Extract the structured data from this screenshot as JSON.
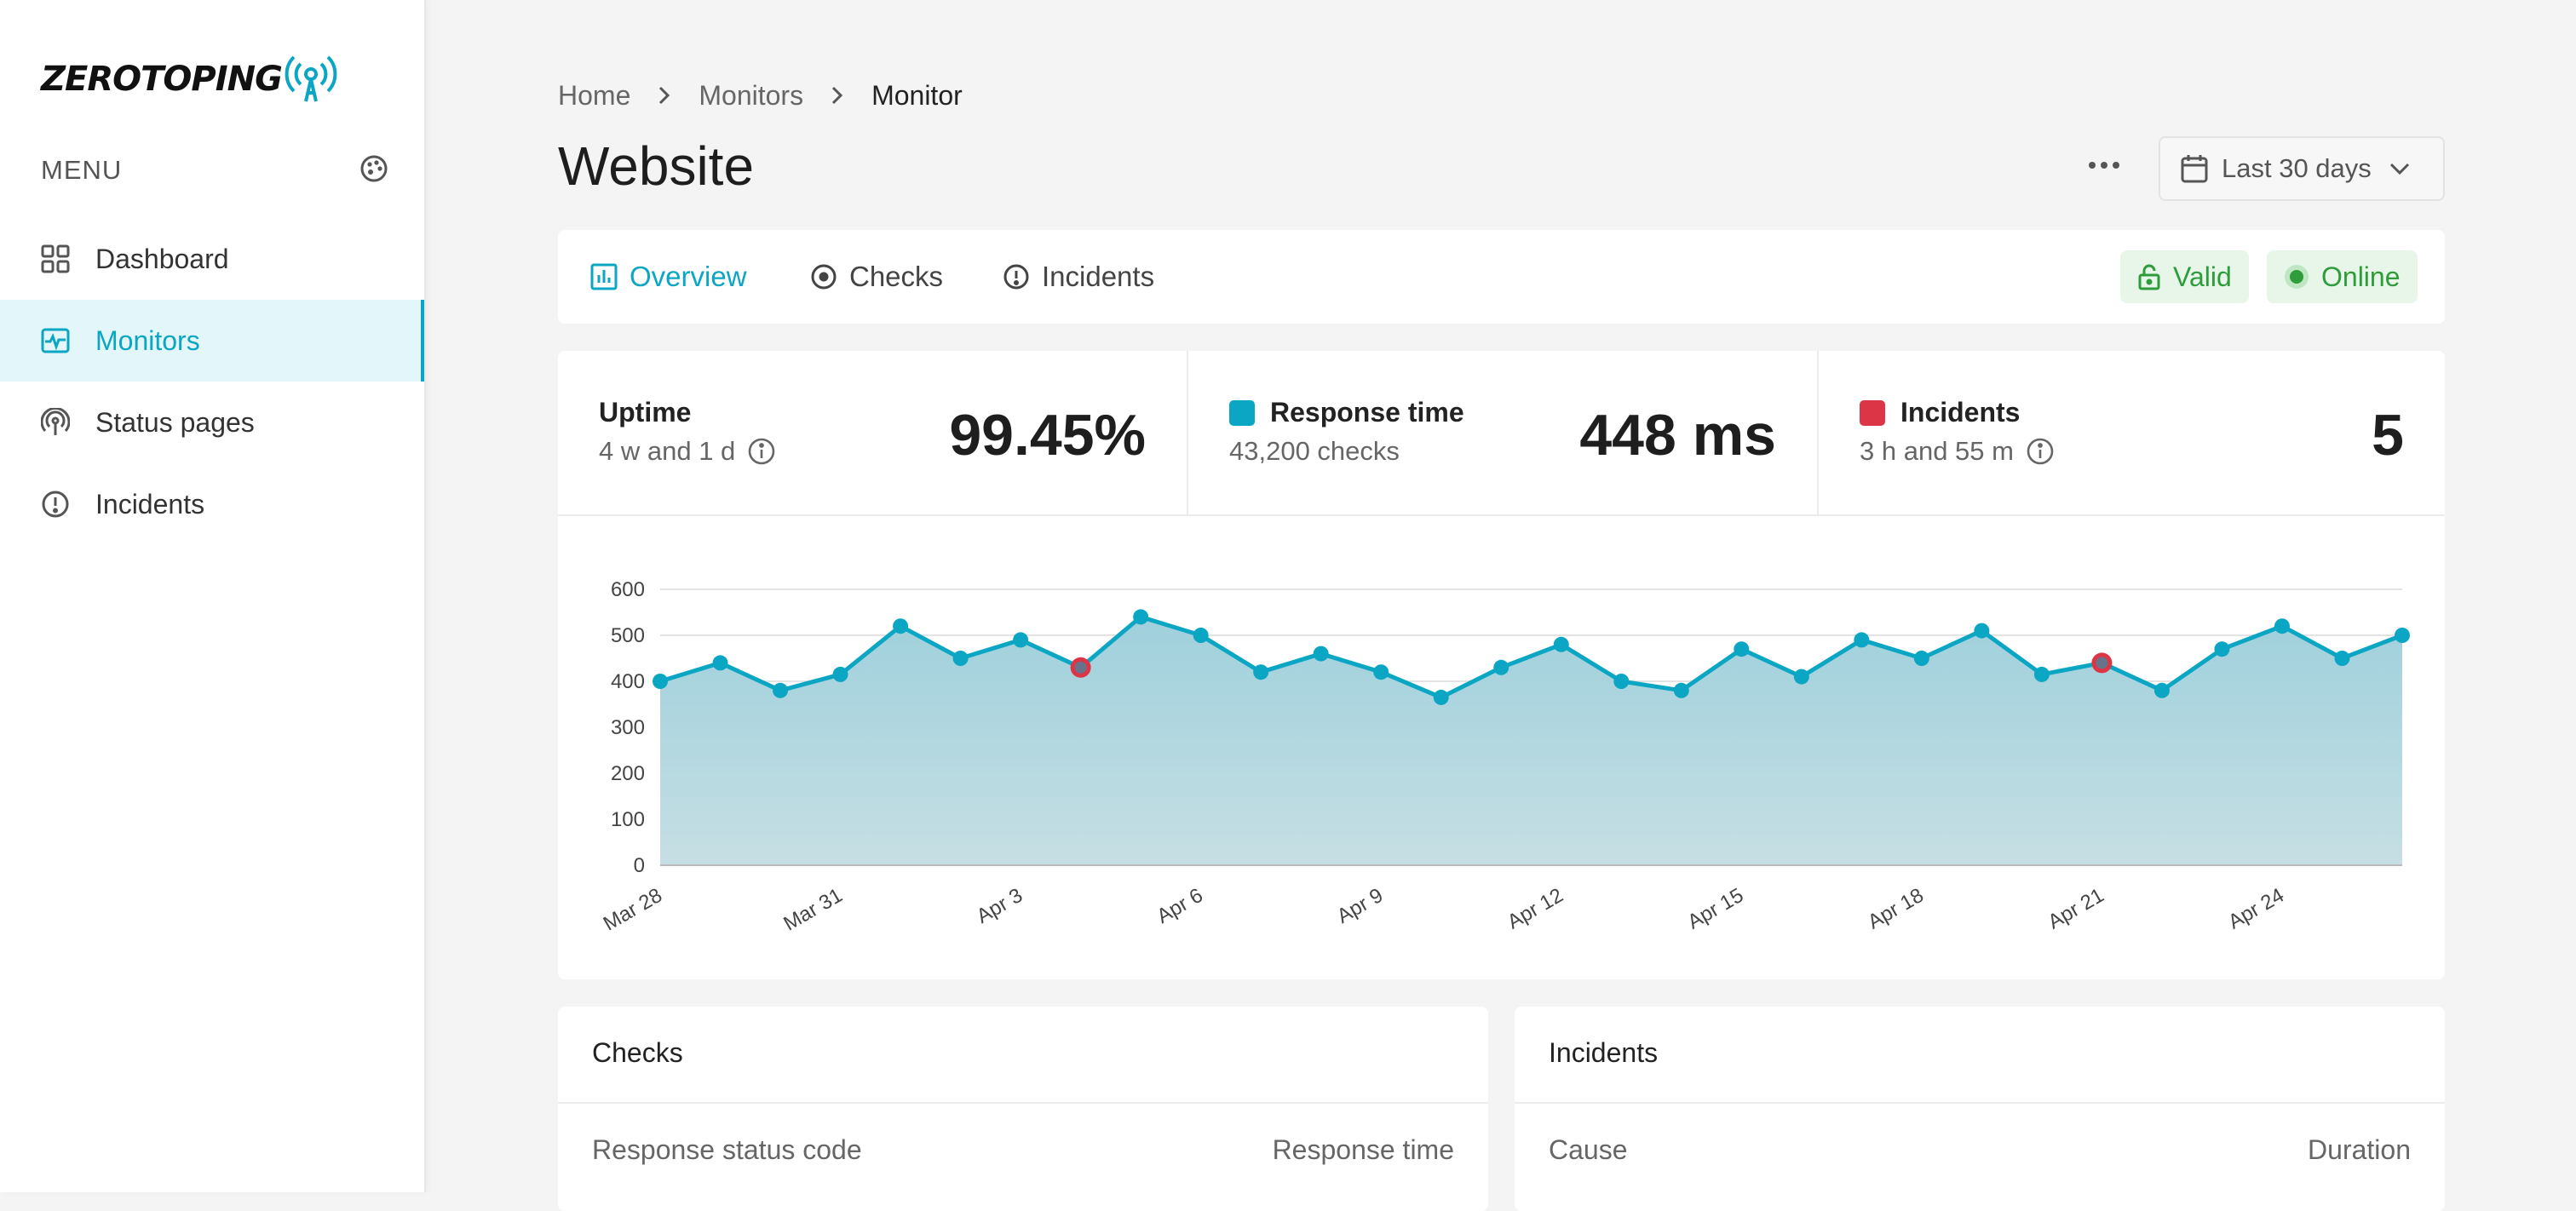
{
  "app": {
    "logo_text": "ZEROTOPING",
    "logo_icon": "broadcast-tower-icon"
  },
  "sidebar": {
    "menu_label": "MENU",
    "menu_icon": "palette-icon",
    "items": [
      {
        "label": "Dashboard",
        "icon": "grid-icon",
        "active": false
      },
      {
        "label": "Monitors",
        "icon": "monitor-pulse-icon",
        "active": true
      },
      {
        "label": "Status pages",
        "icon": "broadcast-icon",
        "active": false
      },
      {
        "label": "Incidents",
        "icon": "alert-circle-icon",
        "active": false
      }
    ]
  },
  "breadcrumb": [
    "Home",
    "Monitors",
    "Monitor"
  ],
  "page": {
    "title": "Website"
  },
  "header_actions": {
    "more_icon": "ellipsis-icon",
    "date_range": "Last 30 days"
  },
  "tabs": [
    {
      "label": "Overview",
      "icon": "bar-chart-icon",
      "active": true
    },
    {
      "label": "Checks",
      "icon": "target-icon",
      "active": false
    },
    {
      "label": "Incidents",
      "icon": "alert-circle-icon",
      "active": false
    }
  ],
  "badges": {
    "ssl": "Valid",
    "status": "Online"
  },
  "stats": {
    "uptime": {
      "title": "Uptime",
      "sub": "4 w and 1 d",
      "value": "99.45%"
    },
    "response": {
      "title": "Response time",
      "sub": "43,200 checks",
      "value": "448 ms",
      "color": "#0aa6c4"
    },
    "incidents": {
      "title": "Incidents",
      "sub": "3 h and 55 m",
      "value": "5",
      "color": "#dc3545"
    }
  },
  "colors": {
    "accent": "#0aa6c4",
    "incident": "#dc3545",
    "online": "#2e9c3b"
  },
  "chart_data": {
    "type": "area",
    "title": "",
    "xlabel": "",
    "ylabel": "",
    "ylim": [
      0,
      600
    ],
    "yticks": [
      0,
      100,
      200,
      300,
      400,
      500,
      600
    ],
    "x": [
      "Mar 28",
      "Mar 29",
      "Mar 30",
      "Mar 31",
      "Apr 1",
      "Apr 2",
      "Apr 3",
      "Apr 4",
      "Apr 5",
      "Apr 6",
      "Apr 7",
      "Apr 8",
      "Apr 9",
      "Apr 10",
      "Apr 11",
      "Apr 12",
      "Apr 13",
      "Apr 14",
      "Apr 15",
      "Apr 16",
      "Apr 17",
      "Apr 18",
      "Apr 19",
      "Apr 20",
      "Apr 21",
      "Apr 22",
      "Apr 23",
      "Apr 24",
      "Apr 25",
      "Apr 26"
    ],
    "xtick_labels": [
      "Mar 28",
      "Mar 31",
      "Apr 3",
      "Apr 6",
      "Apr 9",
      "Apr 12",
      "Apr 15",
      "Apr 18",
      "Apr 21",
      "Apr 24"
    ],
    "series": [
      {
        "name": "Response time",
        "values": [
          400,
          440,
          380,
          415,
          520,
          450,
          490,
          430,
          540,
          500,
          420,
          460,
          420,
          365,
          430,
          480,
          400,
          380,
          470,
          410,
          490,
          450,
          510,
          415,
          440,
          380,
          470,
          520,
          450,
          500
        ]
      }
    ],
    "incident_x": [
      "Apr 4",
      "Apr 21"
    ],
    "grid": true,
    "legend": "none"
  },
  "bottom": {
    "checks": {
      "title": "Checks",
      "col_left": "Response status code",
      "col_right": "Response time"
    },
    "incidents": {
      "title": "Incidents",
      "col_left": "Cause",
      "col_right": "Duration"
    }
  }
}
